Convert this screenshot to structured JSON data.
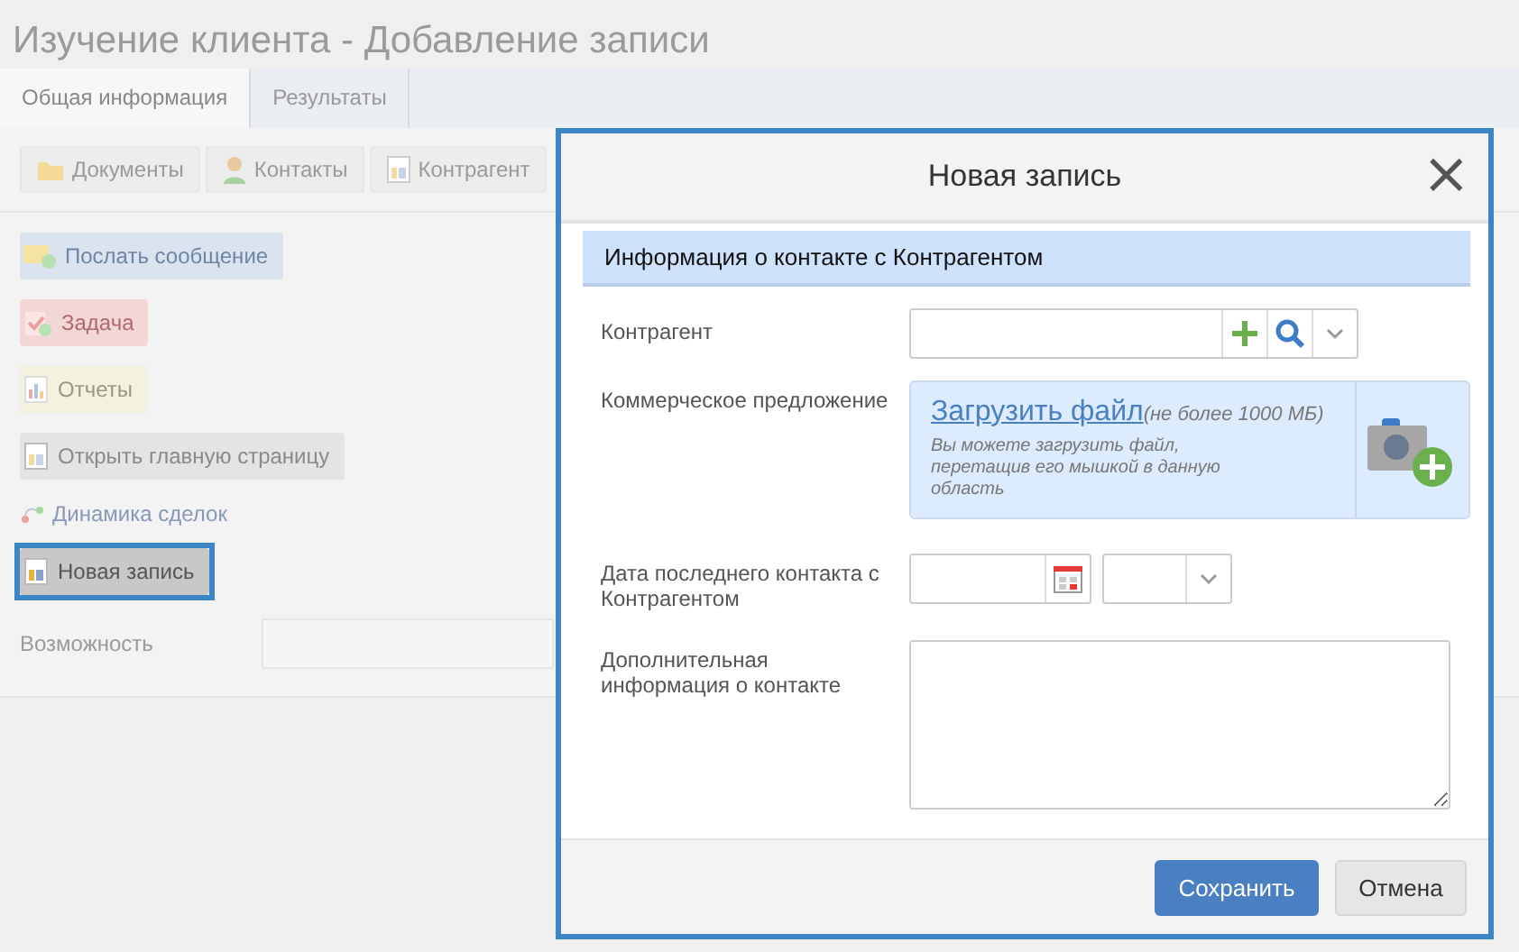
{
  "page": {
    "title": "Изучение клиента - Добавление записи"
  },
  "tabs": [
    {
      "label": "Общая информация",
      "selected": true
    },
    {
      "label": "Результаты",
      "selected": false
    }
  ],
  "toolbar": [
    {
      "label": "Документы",
      "kind": "folder"
    },
    {
      "label": "Контакты",
      "kind": "person"
    },
    {
      "label": "Контрагент",
      "kind": "doc"
    }
  ],
  "actions": [
    {
      "label": "Послать сообщение",
      "kind": "primary",
      "highlighted": false
    },
    {
      "label": "Задача",
      "kind": "danger",
      "highlighted": false
    },
    {
      "label": "Отчеты",
      "kind": "warning",
      "highlighted": false
    },
    {
      "label": "Открыть главную страницу",
      "kind": "default",
      "highlighted": false
    },
    {
      "label": "Динамика сделок",
      "kind": "link",
      "highlighted": false
    },
    {
      "label": "Новая запись",
      "kind": "default",
      "highlighted": true
    }
  ],
  "opportunity": {
    "label": "Возможность"
  },
  "dialog": {
    "title": "Новая запись",
    "close": "×",
    "section": "Информация о контакте с Контрагентом",
    "fields": [
      {
        "label": "Контрагент",
        "kind": "lookup"
      },
      {
        "label": "Коммерческое предложение",
        "kind": "upload",
        "link": "Загрузить файл",
        "limit": "(не более 1000 МБ)",
        "hint": "Вы можете загрузить файл, перетащив его мышкой в данную область"
      },
      {
        "label": "Дата последнего контакта с Контрагентом",
        "kind": "datetime"
      },
      {
        "label": "Дополнительная информация о контакте",
        "kind": "textarea"
      }
    ],
    "buttons": [
      {
        "label": "Сохранить",
        "kind": "primary"
      },
      {
        "label": "Отмена",
        "kind": "default"
      }
    ]
  }
}
